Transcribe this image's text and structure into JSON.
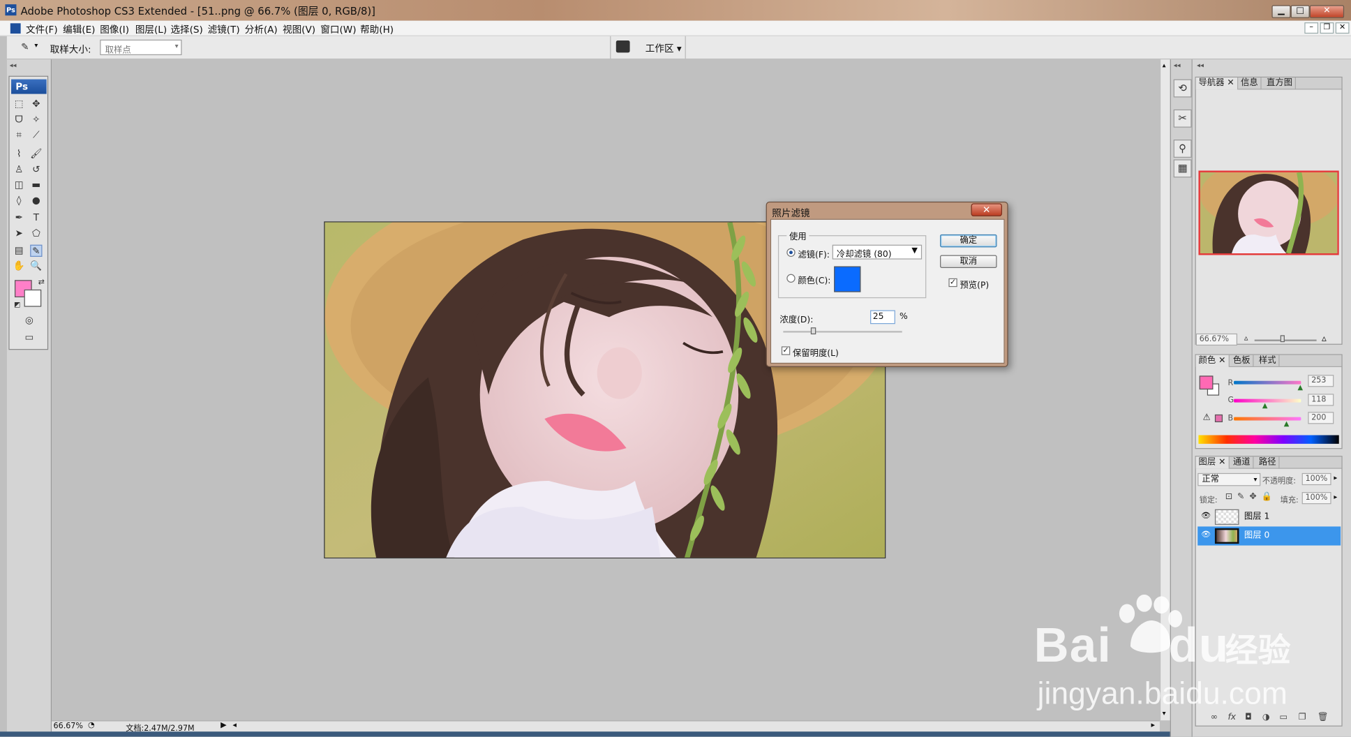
{
  "window": {
    "title": "Adobe Photoshop CS3 Extended - [51..png @ 66.7% (图层 0, RGB/8)]",
    "min": "▁",
    "max": "□",
    "close": "✕"
  },
  "menu": [
    "文件(F)",
    "编辑(E)",
    "图像(I)",
    "图层(L)",
    "选择(S)",
    "滤镜(T)",
    "分析(A)",
    "视图(V)",
    "窗口(W)",
    "帮助(H)"
  ],
  "options": {
    "sample_size_label": "取样大小:",
    "sample_size_value": "取样点",
    "workspace": "工作区"
  },
  "toolbox": {
    "logo": "Ps"
  },
  "colors": {
    "foreground": "#ff7fc8",
    "background": "#ffffff",
    "filter_swatch": "#0a6bff",
    "selected_layer": "#3c96ec"
  },
  "status": {
    "zoom": "66.67%",
    "doc": "文档:2.47M/2.97M"
  },
  "navigator": {
    "tabs": [
      "导航器",
      "信息",
      "直方图"
    ],
    "zoom": "66.67%"
  },
  "color_panel": {
    "tabs": [
      "颜色",
      "色板",
      "样式"
    ],
    "r_label": "R",
    "g_label": "G",
    "b_label": "B",
    "r": "253",
    "g": "118",
    "b": "200"
  },
  "layers_panel": {
    "tabs": [
      "图层",
      "通道",
      "路径"
    ],
    "blend_mode": "正常",
    "opacity_label": "不透明度:",
    "opacity": "100%",
    "lock_label": "锁定:",
    "fill_label": "填充:",
    "fill": "100%",
    "layers": [
      {
        "name": "图层 1",
        "selected": false
      },
      {
        "name": "图层 0",
        "selected": true
      }
    ]
  },
  "dialog": {
    "title": "照片滤镜",
    "close": "✕",
    "group_label": "使用",
    "filter_label": "滤镜(F):",
    "filter_value": "冷却滤镜 (80)",
    "color_label": "颜色(C):",
    "ok": "确定",
    "cancel": "取消",
    "preview_label": "预览(P)",
    "preview_checked": true,
    "density_label": "浓度(D):",
    "density_value": "25",
    "density_unit": "%",
    "preserve_label": "保留明度(L)",
    "preserve_checked": true
  },
  "watermark": {
    "brand": "Bai",
    "du": "du",
    "jingyan": "经验",
    "url": "jingyan.baidu.com"
  }
}
